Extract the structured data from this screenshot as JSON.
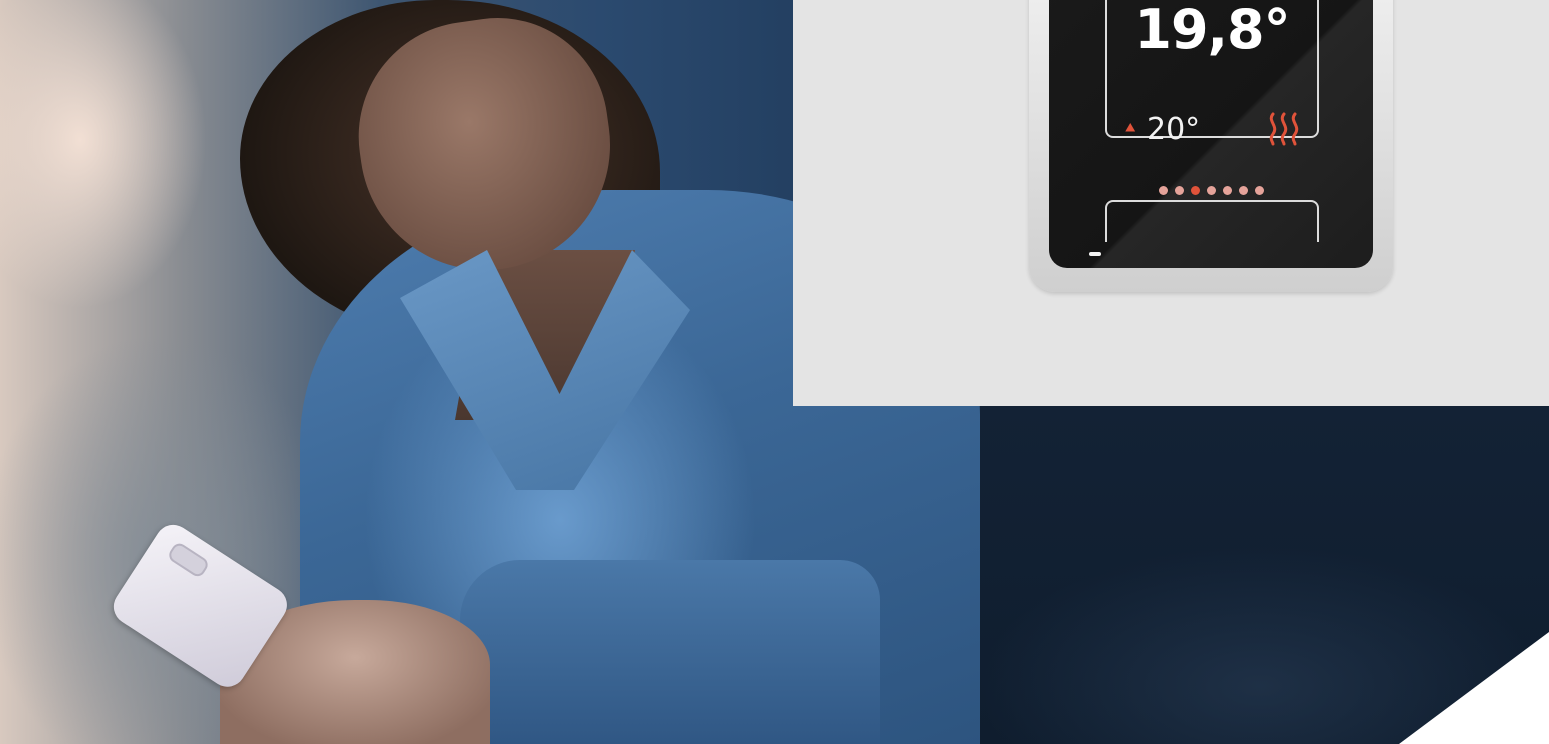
{
  "thermostat": {
    "current_temp": "19,8°",
    "setpoint_temp": "20°",
    "setpoint_icon": "double-chevron-up-icon",
    "heating_icon": "heating-waves-icon",
    "indicator": {
      "count": 7,
      "active_index": 2
    },
    "colors": {
      "accent": "#e0533a",
      "dot_inactive": "#e5a39a",
      "screen_text": "#ffffff",
      "body": "#1a1a1a",
      "bezel": "#e6e6e6"
    }
  },
  "scene": {
    "colors": {
      "pajama_blue": "#4a78a8",
      "inset_background": "#e4e4e4",
      "dark_sheet": "#132235"
    }
  }
}
